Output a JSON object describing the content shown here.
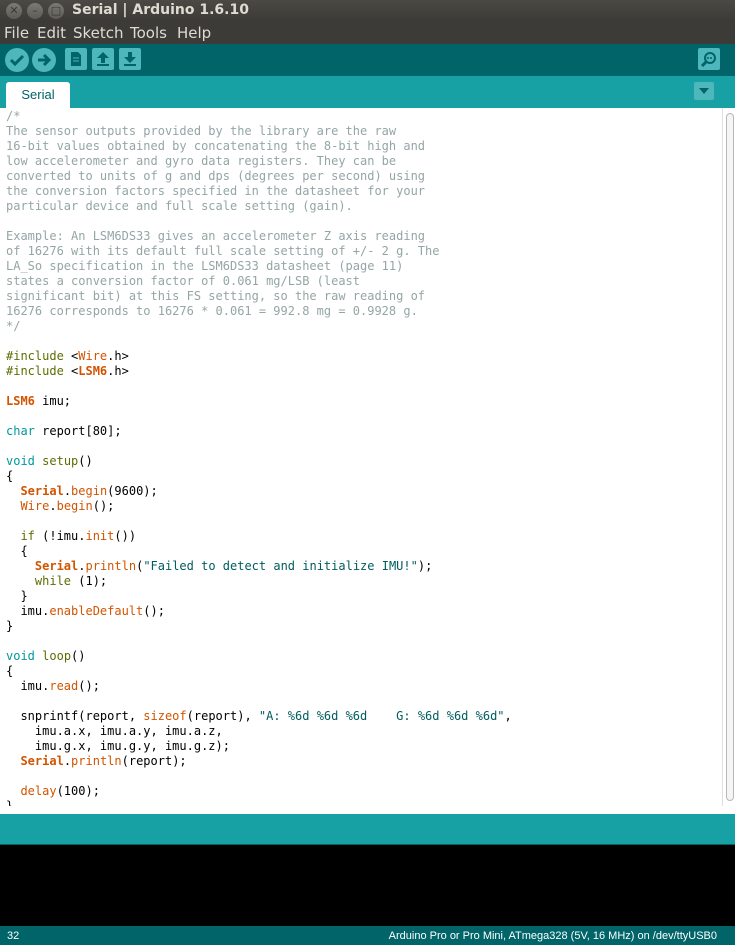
{
  "window": {
    "title": "Serial | Arduino 1.6.10"
  },
  "menu": [
    "File",
    "Edit",
    "Sketch",
    "Tools",
    "Help"
  ],
  "toolbar": {
    "buttons": [
      "verify-icon",
      "upload-icon",
      "new-icon",
      "open-icon",
      "save-icon"
    ],
    "right_button": "serial-monitor-icon"
  },
  "tabs": [
    {
      "label": "Serial"
    }
  ],
  "colors": {
    "accent": "#17a1a5",
    "toolbar": "#006468",
    "comment": "#95a5a6",
    "type": "#00979c",
    "function": "#d35400",
    "string": "#005c5f",
    "keyword": "#5e6d03"
  },
  "code_lines": [
    [
      [
        "c",
        "/*"
      ]
    ],
    [
      [
        "c",
        "The sensor outputs provided by the library are the raw"
      ]
    ],
    [
      [
        "c",
        "16-bit values obtained by concatenating the 8-bit high and"
      ]
    ],
    [
      [
        "c",
        "low accelerometer and gyro data registers. They can be"
      ]
    ],
    [
      [
        "c",
        "converted to units of g and dps (degrees per second) using"
      ]
    ],
    [
      [
        "c",
        "the conversion factors specified in the datasheet for your"
      ]
    ],
    [
      [
        "c",
        "particular device and full scale setting (gain)."
      ]
    ],
    [],
    [
      [
        "c",
        "Example: An LSM6DS33 gives an accelerometer Z axis reading"
      ]
    ],
    [
      [
        "c",
        "of 16276 with its default full scale setting of +/- 2 g. The"
      ]
    ],
    [
      [
        "c",
        "LA_So specification in the LSM6DS33 datasheet (page 11)"
      ]
    ],
    [
      [
        "c",
        "states a conversion factor of 0.061 mg/LSB (least"
      ]
    ],
    [
      [
        "c",
        "significant bit) at this FS setting, so the raw reading of"
      ]
    ],
    [
      [
        "c",
        "16276 corresponds to 16276 * 0.061 = 992.8 mg = 0.9928 g."
      ]
    ],
    [
      [
        "c",
        "*/"
      ]
    ],
    [],
    [
      [
        "k",
        "#include"
      ],
      [
        "d",
        " <"
      ],
      [
        "f",
        "Wire"
      ],
      [
        "d",
        ".h>"
      ]
    ],
    [
      [
        "k",
        "#include"
      ],
      [
        "d",
        " <"
      ],
      [
        "fb",
        "LSM6"
      ],
      [
        "d",
        ".h>"
      ]
    ],
    [],
    [
      [
        "fb",
        "LSM6"
      ],
      [
        "d",
        " imu;"
      ]
    ],
    [],
    [
      [
        "t",
        "char"
      ],
      [
        "d",
        " report[80];"
      ]
    ],
    [],
    [
      [
        "t",
        "void"
      ],
      [
        "d",
        " "
      ],
      [
        "k",
        "setup"
      ],
      [
        "d",
        "()"
      ]
    ],
    [
      [
        "d",
        "{"
      ]
    ],
    [
      [
        "d",
        "  "
      ],
      [
        "fb",
        "Serial"
      ],
      [
        "d",
        "."
      ],
      [
        "f",
        "begin"
      ],
      [
        "d",
        "(9600);"
      ]
    ],
    [
      [
        "d",
        "  "
      ],
      [
        "f",
        "Wire"
      ],
      [
        "d",
        "."
      ],
      [
        "f",
        "begin"
      ],
      [
        "d",
        "();"
      ]
    ],
    [],
    [
      [
        "d",
        "  "
      ],
      [
        "k",
        "if"
      ],
      [
        "d",
        " (!imu."
      ],
      [
        "f",
        "init"
      ],
      [
        "d",
        "())"
      ]
    ],
    [
      [
        "d",
        "  {"
      ]
    ],
    [
      [
        "d",
        "    "
      ],
      [
        "fb",
        "Serial"
      ],
      [
        "d",
        "."
      ],
      [
        "f",
        "println"
      ],
      [
        "d",
        "("
      ],
      [
        "s",
        "\"Failed to detect and initialize IMU!\""
      ],
      [
        "d",
        ");"
      ]
    ],
    [
      [
        "d",
        "    "
      ],
      [
        "k",
        "while"
      ],
      [
        "d",
        " (1);"
      ]
    ],
    [
      [
        "d",
        "  }"
      ]
    ],
    [
      [
        "d",
        "  imu."
      ],
      [
        "f",
        "enableDefault"
      ],
      [
        "d",
        "();"
      ]
    ],
    [
      [
        "d",
        "}"
      ]
    ],
    [],
    [
      [
        "t",
        "void"
      ],
      [
        "d",
        " "
      ],
      [
        "k",
        "loop"
      ],
      [
        "d",
        "()"
      ]
    ],
    [
      [
        "d",
        "{"
      ]
    ],
    [
      [
        "d",
        "  imu."
      ],
      [
        "f",
        "read"
      ],
      [
        "d",
        "();"
      ]
    ],
    [],
    [
      [
        "d",
        "  snprintf(report, "
      ],
      [
        "f",
        "sizeof"
      ],
      [
        "d",
        "(report), "
      ],
      [
        "s",
        "\"A: %6d %6d %6d    G: %6d %6d %6d\""
      ],
      [
        "d",
        ","
      ]
    ],
    [
      [
        "d",
        "    imu.a.x, imu.a.y, imu.a.z,"
      ]
    ],
    [
      [
        "d",
        "    imu.g.x, imu.g.y, imu.g.z);"
      ]
    ],
    [
      [
        "d",
        "  "
      ],
      [
        "fb",
        "Serial"
      ],
      [
        "d",
        "."
      ],
      [
        "f",
        "println"
      ],
      [
        "d",
        "(report);"
      ]
    ],
    [],
    [
      [
        "d",
        "  "
      ],
      [
        "f",
        "delay"
      ],
      [
        "d",
        "(100);"
      ]
    ],
    [
      [
        "d",
        "}"
      ]
    ]
  ],
  "status": {
    "line": "32",
    "board": "Arduino Pro or Pro Mini, ATmega328 (5V, 16 MHz) on /dev/ttyUSB0"
  }
}
